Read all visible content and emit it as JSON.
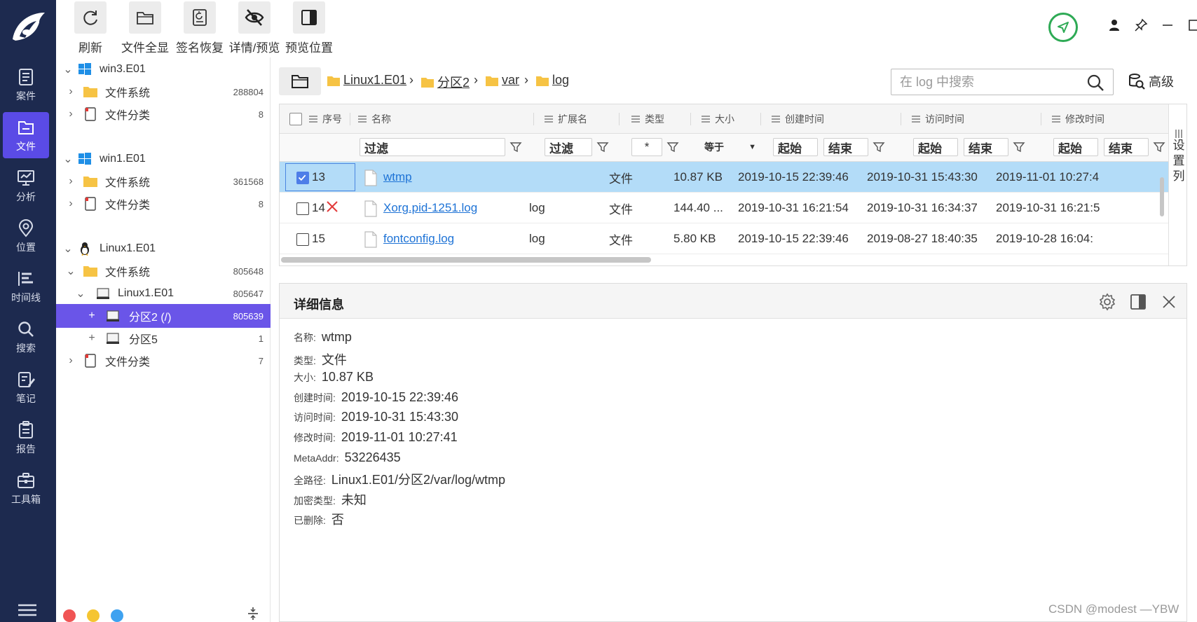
{
  "rail": {
    "items": [
      {
        "label": "案件",
        "icon": "case-icon"
      },
      {
        "label": "文件",
        "icon": "file-icon"
      },
      {
        "label": "分析",
        "icon": "analysis-icon"
      },
      {
        "label": "位置",
        "icon": "location-icon"
      },
      {
        "label": "时间线",
        "icon": "timeline-icon"
      },
      {
        "label": "搜索",
        "icon": "search-icon"
      },
      {
        "label": "笔记",
        "icon": "note-icon"
      },
      {
        "label": "报告",
        "icon": "report-icon"
      },
      {
        "label": "工具箱",
        "icon": "toolbox-icon"
      }
    ],
    "active_index": 1
  },
  "toolbar": {
    "buttons": [
      {
        "label": "刷新",
        "icon": "refresh-icon"
      },
      {
        "label": "文件全显",
        "icon": "folder-icon"
      },
      {
        "label": "签名恢复",
        "icon": "signature-restore-icon"
      },
      {
        "label": "详情/预览",
        "icon": "eye-off-icon"
      },
      {
        "label": "预览位置",
        "icon": "panel-right-icon"
      }
    ]
  },
  "tree": {
    "rows": [
      {
        "label": "win3.E01",
        "count": "",
        "twisty": "⌄"
      },
      {
        "label": "文件系统",
        "count": "288804",
        "twisty": "›"
      },
      {
        "label": "文件分类",
        "count": "8",
        "twisty": "›"
      },
      {
        "label": "win1.E01",
        "count": "",
        "twisty": "⌄"
      },
      {
        "label": "文件系统",
        "count": "361568",
        "twisty": "›"
      },
      {
        "label": "文件分类",
        "count": "8",
        "twisty": "›"
      },
      {
        "label": "Linux1.E01",
        "count": "",
        "twisty": "⌄"
      },
      {
        "label": "文件系统",
        "count": "805648",
        "twisty": "⌄"
      },
      {
        "label": "Linux1.E01",
        "count": "805647",
        "twisty": "⌄"
      },
      {
        "label": "分区2 (/)",
        "count": "805639",
        "twisty": "+"
      },
      {
        "label": "分区5",
        "count": "1",
        "twisty": "+"
      },
      {
        "label": "文件分类",
        "count": "7",
        "twisty": "›"
      }
    ],
    "selected_index": 9
  },
  "breadcrumb": {
    "items": [
      "Linux1.E01",
      "分区2",
      "var",
      "log"
    ],
    "separator": "›"
  },
  "search": {
    "placeholder": "在 log 中搜索",
    "advanced_label": "高级"
  },
  "grid": {
    "headers": {
      "index": "序号",
      "name": "名称",
      "ext": "扩展名",
      "type": "类型",
      "size": "大小",
      "created": "创建时间",
      "accessed": "访问时间",
      "modified": "修改时间"
    },
    "filters": {
      "name": "过滤",
      "ext": "过滤",
      "type": "*",
      "size": "等于",
      "created_start": "起始",
      "created_end": "结束",
      "accessed_start": "起始",
      "accessed_end": "结束",
      "modified_start": "起始",
      "modified_end": "结束"
    },
    "rows": [
      {
        "index": "13",
        "name": "wtmp",
        "ext": "",
        "type": "文件",
        "size": "10.87 KB",
        "created": "2019-10-15 22:39:46",
        "accessed": "2019-10-31 15:43:30",
        "modified": "2019-11-01 10:27:4",
        "checked": true,
        "deleted": false
      },
      {
        "index": "14",
        "name": "Xorg.pid-1251.log",
        "ext": "log",
        "type": "文件",
        "size": "144.40 ...",
        "created": "2019-10-31 16:21:54",
        "accessed": "2019-10-31 16:34:37",
        "modified": "2019-10-31 16:21:5",
        "checked": false,
        "deleted": true
      },
      {
        "index": "15",
        "name": "fontconfig.log",
        "ext": "log",
        "type": "文件",
        "size": "5.80 KB",
        "created": "2019-10-15 22:39:46",
        "accessed": "2019-08-27 18:40:35",
        "modified": "2019-10-28 16:04:",
        "checked": false,
        "deleted": false
      }
    ],
    "column_settings": "设置列"
  },
  "detail": {
    "title": "详细信息",
    "fields": [
      {
        "key": "名称:",
        "value": "wtmp"
      },
      {
        "key": "类型:",
        "value": "文件"
      },
      {
        "key": "大小:",
        "value": "10.87 KB"
      },
      {
        "key": "创建时间:",
        "value": "2019-10-15 22:39:46"
      },
      {
        "key": "访问时间:",
        "value": "2019-10-31 15:43:30"
      },
      {
        "key": "修改时间:",
        "value": "2019-11-01 10:27:41"
      },
      {
        "key": "MetaAddr:",
        "value": "53226435"
      },
      {
        "key": "全路径:",
        "value": "Linux1.E01/分区2/var/log/wtmp"
      },
      {
        "key": "加密类型:",
        "value": "未知"
      },
      {
        "key": "已删除:",
        "value": "否"
      }
    ]
  },
  "watermark": "CSDN @modest —YBW",
  "colors": {
    "rail_bg": "#1d2a4f",
    "rail_active": "#5a4be6",
    "tree_selected": "#6a55e8",
    "row_selected": "#b3dcf8",
    "link": "#1e73d6",
    "status_green": "#2eaa55",
    "deleted_red": "#e23b3b",
    "dot_red": "#f05454",
    "dot_yellow": "#f5c531",
    "dot_blue": "#3fa2f0"
  }
}
